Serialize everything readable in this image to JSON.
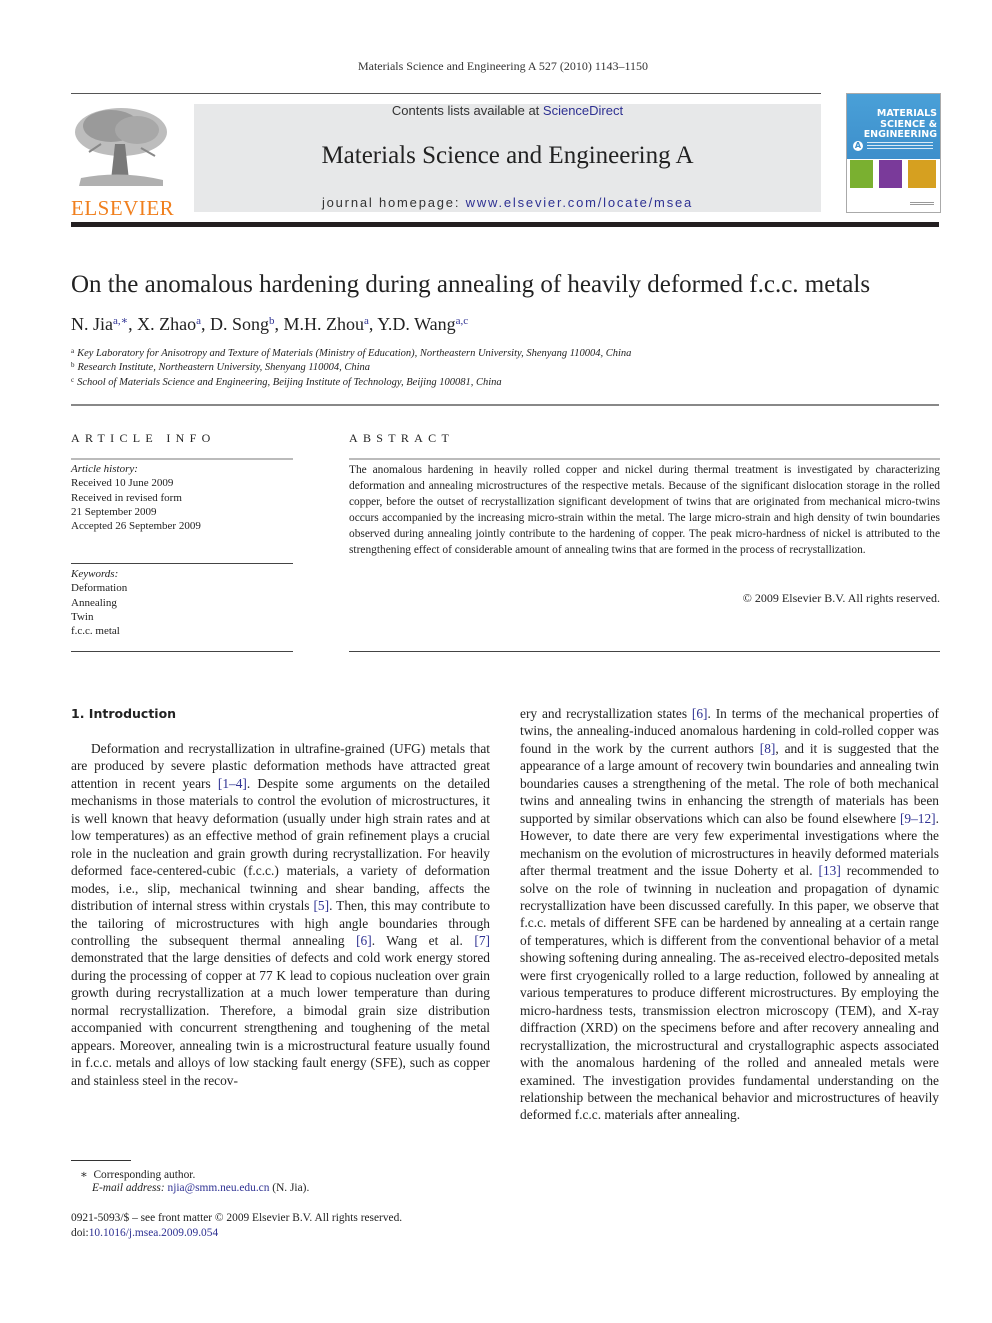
{
  "running_head": "Materials Science and Engineering A 527 (2010) 1143–1150",
  "publisher": {
    "logo_text": "ELSEVIER",
    "brand_color": "#f07f1d"
  },
  "banner": {
    "contents_prefix": "Contents lists available at ",
    "contents_link": "ScienceDirect",
    "journal_title": "Materials Science and Engineering A",
    "homepage_prefix": "journal homepage: ",
    "homepage_link": "www.elsevier.com/locate/msea",
    "link_color": "#2e3192"
  },
  "cover": {
    "line1": "MATERIALS",
    "line2": "SCIENCE &",
    "line3": "ENGINEERING",
    "badge": "A"
  },
  "article": {
    "title": "On the anomalous hardening during annealing of heavily deformed f.c.c. metals",
    "authors": [
      {
        "name": "N. Jia",
        "sup": "a,∗",
        "sep": ", "
      },
      {
        "name": "X. Zhao",
        "sup": "a",
        "sep": ", "
      },
      {
        "name": "D. Song",
        "sup": "b",
        "sep": ", "
      },
      {
        "name": "M.H. Zhou",
        "sup": "a",
        "sep": ", "
      },
      {
        "name": "Y.D. Wang",
        "sup": "a,c",
        "sep": ""
      }
    ],
    "affiliations": [
      {
        "mark": "a",
        "text": "Key Laboratory for Anisotropy and Texture of Materials (Ministry of Education), Northeastern University, Shenyang 110004, China"
      },
      {
        "mark": "b",
        "text": "Research Institute, Northeastern University, Shenyang 110004, China"
      },
      {
        "mark": "c",
        "text": "School of Materials Science and Engineering, Beijing Institute of Technology, Beijing 100081, China"
      }
    ]
  },
  "article_info": {
    "heading": "ARTICLE INFO",
    "history_label": "Article history:",
    "history": [
      "Received 10 June 2009",
      "Received in revised form",
      "21 September 2009",
      "Accepted 26 September 2009"
    ],
    "keywords_label": "Keywords:",
    "keywords": [
      "Deformation",
      "Annealing",
      "Twin",
      "f.c.c. metal"
    ]
  },
  "abstract": {
    "heading": "ABSTRACT",
    "text": "The anomalous hardening in heavily rolled copper and nickel during thermal treatment is investigated by characterizing deformation and annealing microstructures of the respective metals. Because of the significant dislocation storage in the rolled copper, before the outset of recrystallization significant development of twins that are originated from mechanical micro-twins occurs accompanied by the increasing micro-strain within the metal. The large micro-strain and high density of twin boundaries observed during annealing jointly contribute to the hardening of copper. The peak micro-hardness of nickel is attributed to the strengthening effect of considerable amount of annealing twins that are formed in the process of recrystallization.",
    "copyright": "© 2009 Elsevier B.V. All rights reserved."
  },
  "introduction": {
    "heading": "1.  Introduction",
    "col1": [
      {
        "t": "Deformation and recrystallization in ultrafine-grained (UFG) metals that are produced by severe plastic deformation methods have attracted great attention in recent years "
      },
      {
        "c": "[1–4]"
      },
      {
        "t": ". Despite some arguments on the detailed mechanisms in those materials to control the evolution of microstructures, it is well known that heavy deformation (usually under high strain rates and at low temperatures) as an effective method of grain refinement plays a crucial role in the nucleation and grain growth during recrystallization. For heavily deformed face-centered-cubic (f.c.c.) materials, a variety of deformation modes, i.e., slip, mechanical twinning and shear banding, affects the distribution of internal stress within crystals "
      },
      {
        "c": "[5]"
      },
      {
        "t": ". Then, this may contribute to the tailoring of microstructures with high angle boundaries through controlling the subsequent thermal annealing "
      },
      {
        "c": "[6]"
      },
      {
        "t": ". Wang et al. "
      },
      {
        "c": "[7]"
      },
      {
        "t": " demonstrated that the large densities of defects and cold work energy stored during the processing of copper at 77 K lead to copious nucleation over grain growth during recrystallization at a much lower temperature than during normal recrystallization. Therefore, a bimodal grain size distribution accompanied with concurrent strengthening and toughening of the metal appears. Moreover, annealing twin is a microstructural feature usually found in f.c.c. metals and alloys of low stacking fault energy (SFE), such as copper and stainless steel in the recov-"
      }
    ],
    "col2": [
      {
        "t": "ery and recrystallization states "
      },
      {
        "c": "[6]"
      },
      {
        "t": ". In terms of the mechanical properties of twins, the annealing-induced anomalous hardening in cold-rolled copper was found in the work by the current authors "
      },
      {
        "c": "[8]"
      },
      {
        "t": ", and it is suggested that the appearance of a large amount of recovery twin boundaries and annealing twin boundaries causes a strengthening of the metal. The role of both mechanical twins and annealing twins in enhancing the strength of materials has been supported by similar observations which can also be found elsewhere "
      },
      {
        "c": "[9–12]"
      },
      {
        "t": ". However, to date there are very few experimental investigations where the mechanism on the evolution of microstructures in heavily deformed materials after thermal treatment and the issue Doherty et al. "
      },
      {
        "c": "[13]"
      },
      {
        "t": " recommended to solve on the role of twinning in nucleation and propagation of dynamic recrystallization have been discussed carefully. In this paper, we observe that f.c.c. metals of different SFE can be hardened by annealing at a certain range of temperatures, which is different from the conventional behavior of a metal showing softening during annealing. The as-received electro-deposited metals were first cryogenically rolled to a large reduction, followed by annealing at various temperatures to produce different microstructures. By employing the micro-hardness tests, transmission electron microscopy (TEM), and X-ray diffraction (XRD) on the specimens before and after recovery annealing and recrystallization, the microstructural and crystallographic aspects associated with the anomalous hardening of the rolled and annealed metals were examined. The investigation provides fundamental understanding on the relationship between the mechanical behavior and microstructures of heavily deformed f.c.c. materials after annealing."
      }
    ]
  },
  "footnotes": {
    "star": "∗",
    "corresponding": "Corresponding author.",
    "email_label": "E-mail address: ",
    "email": "njia@smm.neu.edu.cn",
    "email_suffix": " (N. Jia).",
    "issn_line": "0921-5093/$ – see front matter © 2009 Elsevier B.V. All rights reserved.",
    "doi_label": "doi:",
    "doi": "10.1016/j.msea.2009.09.054"
  }
}
